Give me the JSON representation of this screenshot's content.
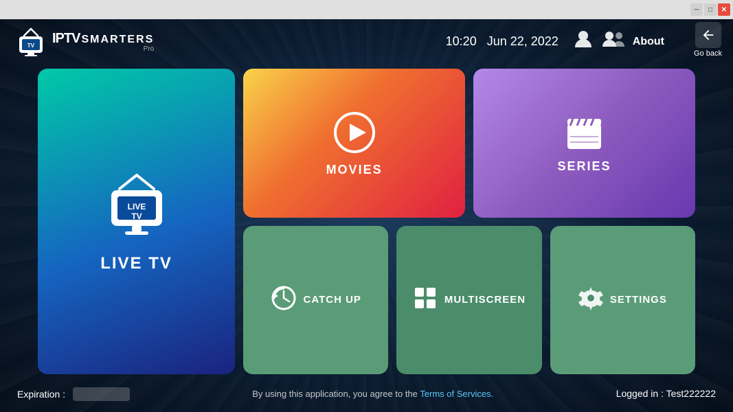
{
  "titlebar": {
    "min_label": "─",
    "max_label": "□",
    "close_label": "✕"
  },
  "goback": {
    "label": "Go back",
    "icon": "↩"
  },
  "header": {
    "logo_iptv": "IPTV",
    "logo_smarters": "SMARTERS",
    "logo_pro": "Pro",
    "time": "10:20",
    "date": "Jun 22, 2022",
    "about_label": "About"
  },
  "cards": {
    "livetv": {
      "label": "LIVE TV",
      "sublabel": "LIVE TV"
    },
    "movies": {
      "label": "MOVIES"
    },
    "series": {
      "label": "SERIES"
    },
    "catchup": {
      "label": "CATCH UP"
    },
    "multiscreen": {
      "label": "MULTISCREEN"
    },
    "settings": {
      "label": "SETTINGS"
    }
  },
  "footer": {
    "expiration_label": "Expiration :",
    "expiration_value": "",
    "terms_text": "By using this application, you agree to the ",
    "terms_link": "Terms of Services.",
    "logged_in": "Logged in : Test222222"
  }
}
